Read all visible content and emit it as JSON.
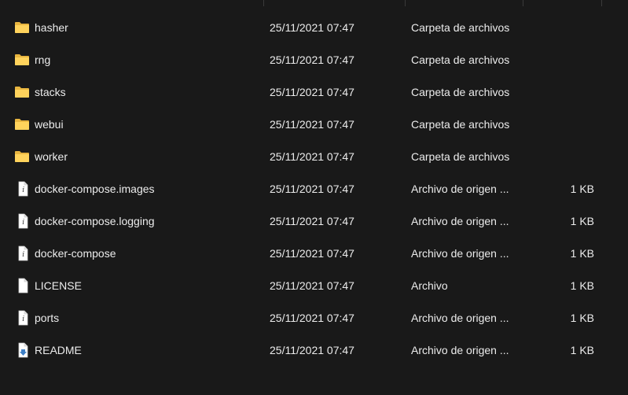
{
  "rows": [
    {
      "name": "hasher",
      "date": "25/11/2021 07:47",
      "type": "Carpeta de archivos",
      "size": "",
      "icon": "folder-icon"
    },
    {
      "name": "rng",
      "date": "25/11/2021 07:47",
      "type": "Carpeta de archivos",
      "size": "",
      "icon": "folder-icon"
    },
    {
      "name": "stacks",
      "date": "25/11/2021 07:47",
      "type": "Carpeta de archivos",
      "size": "",
      "icon": "folder-icon"
    },
    {
      "name": "webui",
      "date": "25/11/2021 07:47",
      "type": "Carpeta de archivos",
      "size": "",
      "icon": "folder-icon"
    },
    {
      "name": "worker",
      "date": "25/11/2021 07:47",
      "type": "Carpeta de archivos",
      "size": "",
      "icon": "folder-icon"
    },
    {
      "name": "docker-compose.images",
      "date": "25/11/2021 07:47",
      "type": "Archivo de origen ...",
      "size": "1 KB",
      "icon": "source-file-icon"
    },
    {
      "name": "docker-compose.logging",
      "date": "25/11/2021 07:47",
      "type": "Archivo de origen ...",
      "size": "1 KB",
      "icon": "source-file-icon"
    },
    {
      "name": "docker-compose",
      "date": "25/11/2021 07:47",
      "type": "Archivo de origen ...",
      "size": "1 KB",
      "icon": "source-file-icon"
    },
    {
      "name": "LICENSE",
      "date": "25/11/2021 07:47",
      "type": "Archivo",
      "size": "1 KB",
      "icon": "file-icon"
    },
    {
      "name": "ports",
      "date": "25/11/2021 07:47",
      "type": "Archivo de origen ...",
      "size": "1 KB",
      "icon": "source-file-icon"
    },
    {
      "name": "README",
      "date": "25/11/2021 07:47",
      "type": "Archivo de origen ...",
      "size": "1 KB",
      "icon": "readme-file-icon"
    }
  ],
  "colors": {
    "background": "#191919",
    "text": "#ececec",
    "folder_front": "#ffd35c",
    "folder_back": "#e8b540",
    "file_body": "#ffffff",
    "readme_accent": "#3d7fc6"
  }
}
